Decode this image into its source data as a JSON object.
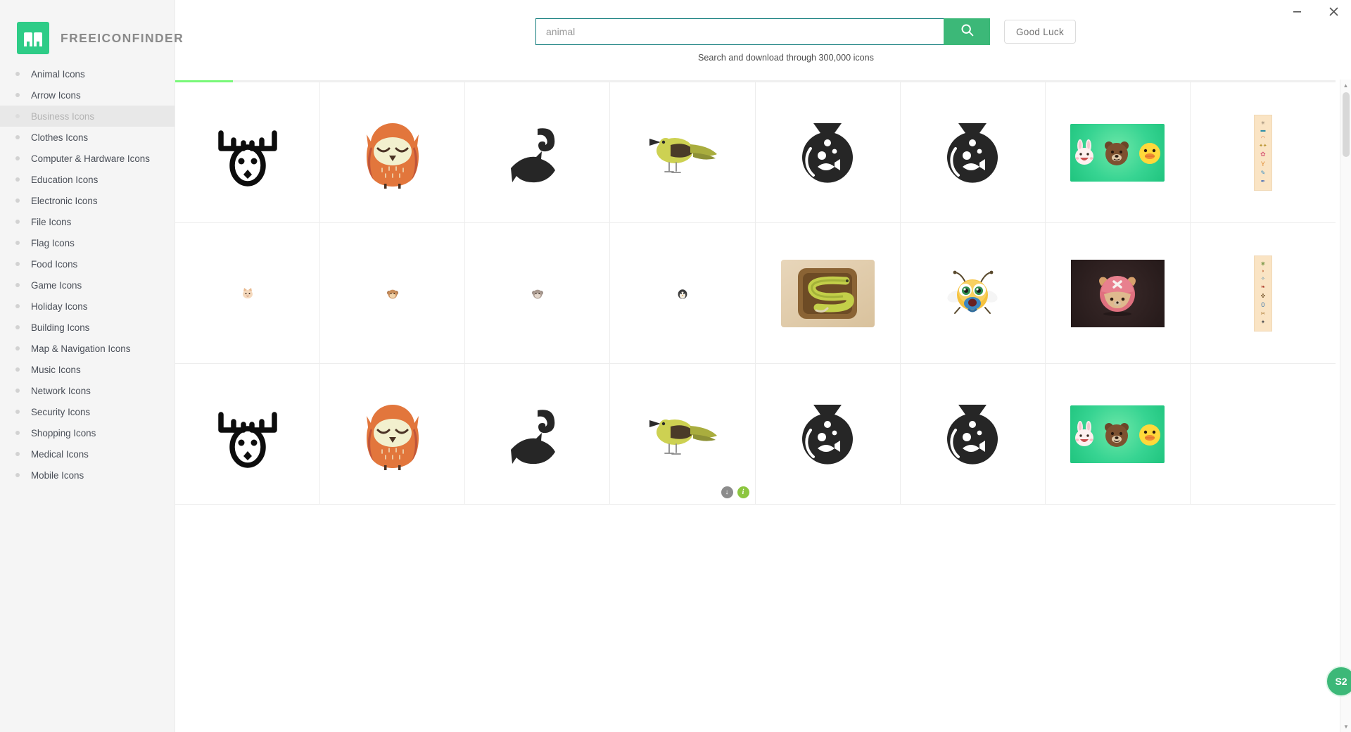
{
  "window": {
    "minimize_label": "−",
    "close_label": "×"
  },
  "brand": {
    "name": "FREEICONFINDER",
    "logo_icon": "building-logo-icon",
    "accent_color": "#2ecc87"
  },
  "sidebar": {
    "items": [
      {
        "label": "Animal Icons",
        "active": false
      },
      {
        "label": "Arrow Icons",
        "active": false
      },
      {
        "label": "Business Icons",
        "active": true
      },
      {
        "label": "Clothes Icons",
        "active": false
      },
      {
        "label": "Computer & Hardware Icons",
        "active": false
      },
      {
        "label": "Education Icons",
        "active": false
      },
      {
        "label": "Electronic Icons",
        "active": false
      },
      {
        "label": "File Icons",
        "active": false
      },
      {
        "label": "Flag Icons",
        "active": false
      },
      {
        "label": "Food Icons",
        "active": false
      },
      {
        "label": "Game Icons",
        "active": false
      },
      {
        "label": "Holiday Icons",
        "active": false
      },
      {
        "label": "Building Icons",
        "active": false
      },
      {
        "label": "Map & Navigation Icons",
        "active": false
      },
      {
        "label": "Music Icons",
        "active": false
      },
      {
        "label": "Network Icons",
        "active": false
      },
      {
        "label": "Security Icons",
        "active": false
      },
      {
        "label": "Shopping Icons",
        "active": false
      },
      {
        "label": "Medical Icons",
        "active": false
      },
      {
        "label": "Mobile Icons",
        "active": false
      }
    ]
  },
  "search": {
    "value": "animal",
    "placeholder": "animal",
    "button_icon": "search-icon",
    "lucky_button_label": "Good Luck",
    "tagline": "Search and download through 300,000 icons",
    "border_color": "#0f7b7b",
    "button_color": "#3cb878"
  },
  "progress": {
    "percent": 5,
    "color": "#79f879"
  },
  "results": {
    "row_actions": {
      "download_label": "↓",
      "info_label": "i"
    },
    "items": [
      {
        "name": "deer-head-outline-icon",
        "art": "deer"
      },
      {
        "name": "owl-icon",
        "art": "owl"
      },
      {
        "name": "fish-hook-icon",
        "art": "fishhook"
      },
      {
        "name": "bird-icon",
        "art": "bird"
      },
      {
        "name": "fishbowl-icon",
        "art": "fishbowl"
      },
      {
        "name": "fishbowl-icon",
        "art": "fishbowl"
      },
      {
        "name": "line-characters-thumbnail",
        "art": "line"
      },
      {
        "name": "sprite-sheet-thumbnail",
        "art": "sprite"
      },
      {
        "name": "cat-face-thumbnail",
        "art": "tinycat"
      },
      {
        "name": "monkey-face-thumbnail",
        "art": "tinymonkey"
      },
      {
        "name": "monkey-face-thumbnail",
        "art": "tinymonkey2"
      },
      {
        "name": "penguin-face-thumbnail",
        "art": "tinypenguin"
      },
      {
        "name": "snake-app-icon",
        "art": "snake"
      },
      {
        "name": "bee-character-icon",
        "art": "bee"
      },
      {
        "name": "chopper-character-thumbnail",
        "art": "chopper"
      },
      {
        "name": "sprite-sheet-thumbnail",
        "art": "sprite2"
      },
      {
        "name": "deer-head-outline-icon",
        "art": "deer"
      },
      {
        "name": "owl-icon",
        "art": "owl"
      },
      {
        "name": "fish-hook-icon",
        "art": "fishhook"
      },
      {
        "name": "bird-icon",
        "art": "bird",
        "actions": true
      },
      {
        "name": "fishbowl-icon",
        "art": "fishbowl"
      },
      {
        "name": "fishbowl-icon",
        "art": "fishbowl"
      },
      {
        "name": "line-characters-thumbnail",
        "art": "line"
      },
      {
        "name": "empty-cell",
        "art": "none"
      }
    ]
  },
  "scrollbar": {
    "up_arrow": "▲",
    "down_arrow": "▼"
  },
  "float_badge": {
    "label": "S2"
  }
}
